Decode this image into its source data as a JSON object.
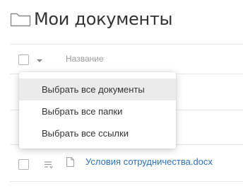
{
  "header": {
    "title": "Мои документы",
    "folder_icon": "folder-icon"
  },
  "table": {
    "columns": [
      "Название"
    ],
    "select_all_icon": "chevron-down-icon"
  },
  "select_menu": {
    "items": [
      {
        "label": "Выбрать все документы",
        "highlighted": true
      },
      {
        "label": "Выбрать все папки",
        "highlighted": false
      },
      {
        "label": "Выбрать все ссылки",
        "highlighted": false
      }
    ]
  },
  "files": [
    {
      "name": "Условия сотрудничества.docx",
      "row_icon": "list-icon",
      "type_icon": "document-icon"
    }
  ],
  "colors": {
    "link": "#2d72c2",
    "menu_highlight": "#ebebeb",
    "divider": "#e6e6e6"
  }
}
